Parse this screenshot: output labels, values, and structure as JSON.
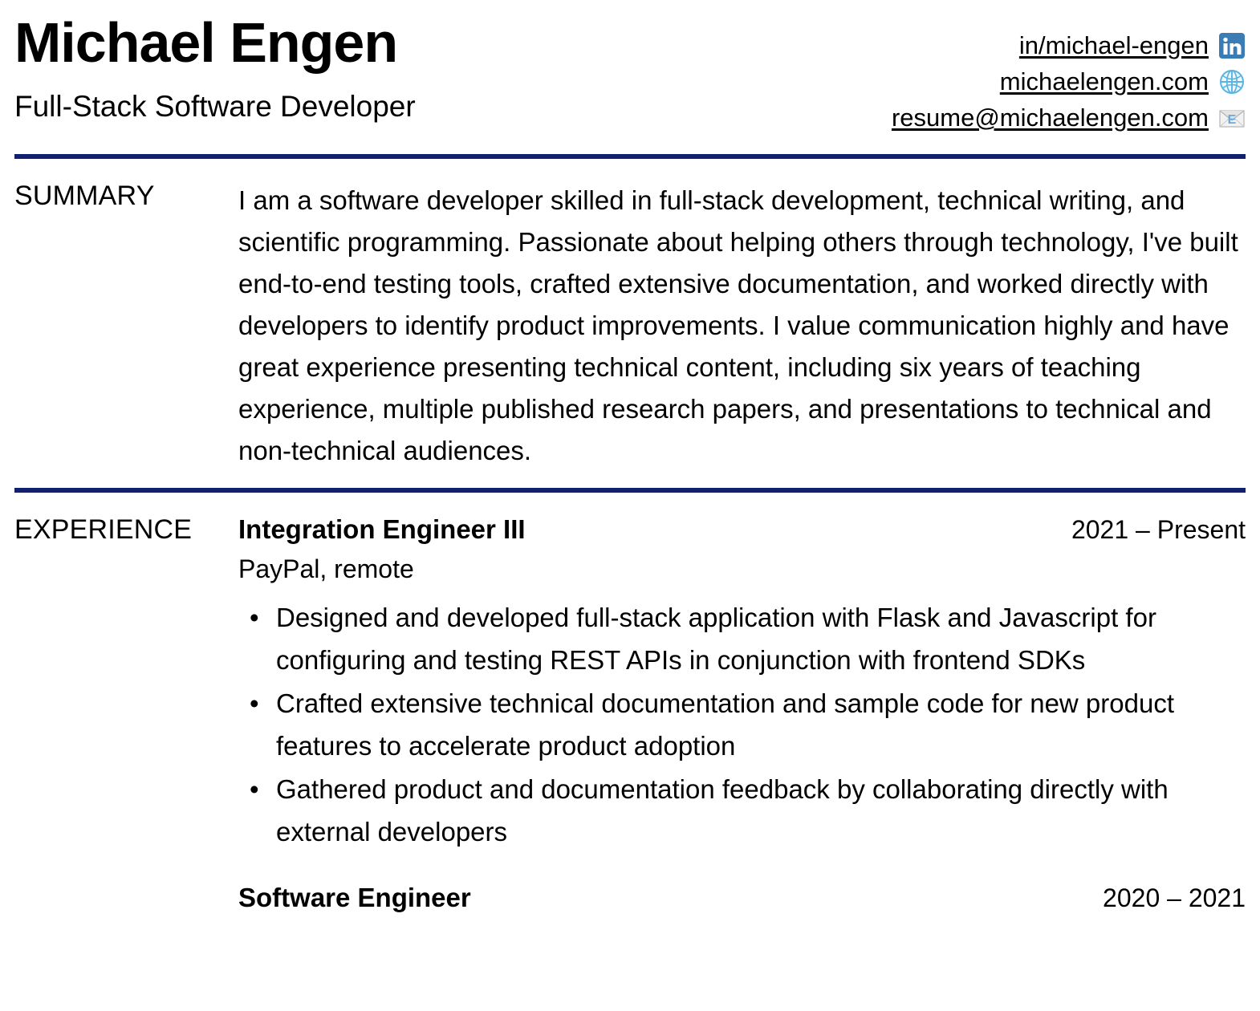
{
  "header": {
    "name": "Michael Engen",
    "title": "Full-Stack Software Developer",
    "contacts": [
      {
        "label": "in/michael-engen",
        "icon": "linkedin-icon"
      },
      {
        "label": "michaelengen.com",
        "icon": "globe-icon"
      },
      {
        "label": "resume@michaelengen.com",
        "icon": "email-icon"
      }
    ]
  },
  "summary": {
    "label": "SUMMARY",
    "text": "I am a software developer skilled in full-stack development, technical writing, and scientific programming. Passionate about helping others through technology, I've built end-to-end testing tools, crafted extensive documentation, and worked directly with developers to identify product improvements. I value communication highly and have great experience presenting technical content, including six years of teaching experience, multiple published research papers, and presentations to technical and non-technical audiences."
  },
  "experience": {
    "label": "EXPERIENCE",
    "jobs": [
      {
        "role": "Integration Engineer III",
        "dates": "2021 – Present",
        "org": "PayPal, remote",
        "bullets": [
          "Designed and developed full-stack application with Flask and Javascript for configuring and testing REST APIs in conjunction with frontend SDKs",
          "Crafted extensive technical documentation and sample code for new product features to accelerate product adoption",
          "Gathered product and documentation feedback by collaborating directly with external developers"
        ]
      },
      {
        "role": "Software Engineer",
        "dates": "2020 – 2021",
        "org": "",
        "bullets": []
      }
    ]
  },
  "colors": {
    "rule": "#122070",
    "linkedin": "#3b7cb5",
    "globe": "#5ab4e0",
    "envelope": "#d8d8d8"
  }
}
